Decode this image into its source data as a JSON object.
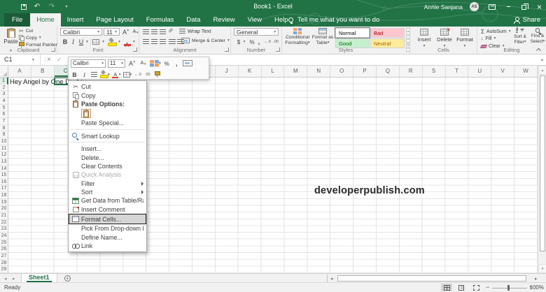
{
  "colors": {
    "accent_green": "#217346",
    "selection_border": "#217346"
  },
  "title_bar": {
    "title": "Book1 - Excel",
    "user_name": "Annie Sanjana",
    "user_initials": "AS",
    "quick_access_icons": [
      "save-icon",
      "undo-icon",
      "redo-icon",
      "customize-quick-access-icon"
    ],
    "window_icons": [
      "ribbon-display-options-icon",
      "minimize-icon",
      "restore-icon",
      "close-icon"
    ]
  },
  "tab_row": {
    "tabs": [
      "File",
      "Home",
      "Insert",
      "Page Layout",
      "Formulas",
      "Data",
      "Review",
      "View",
      "Help"
    ],
    "active_tab": "Home",
    "tell_me": "Tell me what you want to do",
    "share_label": "Share"
  },
  "ribbon": {
    "clipboard": {
      "label": "Clipboard",
      "paste": "Paste",
      "cut": "Cut",
      "copy": "Copy",
      "format_painter": "Format Painter"
    },
    "font": {
      "label": "Font",
      "font_name": "Calibri",
      "font_size": "11"
    },
    "alignment": {
      "label": "Alignment",
      "wrap_text": "Wrap Text",
      "merge_center": "Merge & Center"
    },
    "number": {
      "label": "Number",
      "number_format": "General"
    },
    "styles": {
      "label": "Styles",
      "conditional_formatting": "Conditional Formatting",
      "format_as_table": "Format as Table",
      "gallery": [
        {
          "name": "Normal",
          "bg": "#FFFFFF",
          "color": "#000000"
        },
        {
          "name": "Bad",
          "bg": "#FFC7CE",
          "color": "#9C0006"
        },
        {
          "name": "Good",
          "bg": "#C6EFCE",
          "color": "#006100"
        },
        {
          "name": "Neutral",
          "bg": "#FFEB9C",
          "color": "#9C6500"
        }
      ]
    },
    "cells": {
      "label": "Cells",
      "insert": "Insert",
      "delete": "Delete",
      "format": "Format"
    },
    "editing": {
      "label": "Editing",
      "autosum": "AutoSum",
      "fill": "Fill",
      "clear": "Clear",
      "sort_filter": "Sort & Filter",
      "find_select": "Find & Select"
    }
  },
  "formula_bar": {
    "name_box": "C1"
  },
  "mini_toolbar": {
    "font_name": "Calibri",
    "font_size": "11"
  },
  "context_menu": {
    "items": [
      {
        "label": "Cut",
        "icon": "scissors-icon"
      },
      {
        "label": "Copy",
        "icon": "copy-icon"
      },
      {
        "label": "Paste Options:",
        "icon": "clipboard-icon",
        "bold": true
      },
      {
        "type": "paste-swatch",
        "icon": "paste-clipboard-icon"
      },
      {
        "label": "Paste Special...",
        "icon": ""
      },
      {
        "type": "separator"
      },
      {
        "label": "Smart Lookup",
        "icon": "smart-lookup-icon"
      },
      {
        "type": "separator"
      },
      {
        "label": "Insert...",
        "icon": ""
      },
      {
        "label": "Delete...",
        "icon": ""
      },
      {
        "label": "Clear Contents",
        "icon": ""
      },
      {
        "label": "Quick Analysis",
        "icon": "quick-analysis-icon",
        "disabled": true
      },
      {
        "label": "Filter",
        "icon": "",
        "submenu": true
      },
      {
        "label": "Sort",
        "icon": "",
        "submenu": true
      },
      {
        "label": "Get Data from Table/Range...",
        "icon": "table-icon"
      },
      {
        "label": "Insert Comment",
        "icon": "comment-icon"
      },
      {
        "label": "Format Cells...",
        "icon": "format-cells-icon",
        "highlighted": true
      },
      {
        "label": "Pick From Drop-down List...",
        "icon": ""
      },
      {
        "label": "Define Name...",
        "icon": ""
      },
      {
        "label": "Link",
        "icon": "link-icon"
      }
    ]
  },
  "sheet": {
    "selected_cell": "C1",
    "selected_column": "C",
    "selected_row": "1",
    "cell_a1": "Hey Angel by One Direction",
    "columns": [
      "A",
      "B",
      "C",
      "D",
      "E",
      "F",
      "G",
      "H",
      "I",
      "J",
      "K",
      "L",
      "M",
      "N",
      "O",
      "P",
      "Q",
      "R",
      "S",
      "T",
      "U",
      "V",
      "W"
    ],
    "rows": [
      "1",
      "2",
      "3",
      "4",
      "5",
      "6",
      "7",
      "8",
      "9",
      "10",
      "11",
      "12",
      "13",
      "14",
      "15",
      "16",
      "17",
      "18",
      "19",
      "20",
      "21",
      "22",
      "23",
      "24",
      "25",
      "26",
      "27",
      "28",
      "29"
    ]
  },
  "watermark": "developerpublish.com",
  "sheet_tab_bar": {
    "active_tab": "Sheet1"
  },
  "status_bar": {
    "status": "Ready",
    "zoom_level": "100%",
    "view_icons": [
      "normal-view-icon",
      "page-layout-icon",
      "page-break-preview-icon"
    ]
  }
}
